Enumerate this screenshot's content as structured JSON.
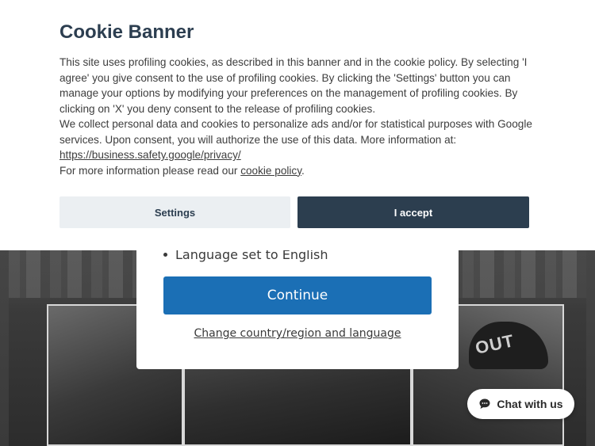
{
  "cookie_banner": {
    "title": "Cookie Banner",
    "paragraph_1": "This site uses profiling cookies, as described in this banner and in the cookie policy. By selecting 'I agree' you give consent to the use of profiling cookies. By clicking the 'Settings' button you can manage your options by modifying your preferences on the management of profiling cookies. By clicking on 'X' you deny consent to the release of profiling cookies.",
    "paragraph_2": "We collect personal data and cookies to personalize ads and/or for statistical purposes with Google services. Upon consent, you will authorize the use of this data. More information at:",
    "privacy_link": "https://business.safety.google/privacy/",
    "more_info_prefix": "For more information please read our ",
    "cookie_policy_link": "cookie policy",
    "more_info_suffix": ".",
    "settings_label": "Settings",
    "accept_label": "I accept"
  },
  "region_modal": {
    "items": [
      "Language set to English"
    ],
    "continue_label": "Continue",
    "change_link": "Change country/region and language"
  },
  "hero": {
    "cap_text": "OUT"
  },
  "chat": {
    "label": "Chat with us",
    "icon": "chat-bubble-icon"
  },
  "colors": {
    "primary_blue": "#1b6fb5",
    "accept_dark": "#2c3e4f",
    "settings_light": "#ebeff2",
    "title_color": "#2c3e50"
  }
}
